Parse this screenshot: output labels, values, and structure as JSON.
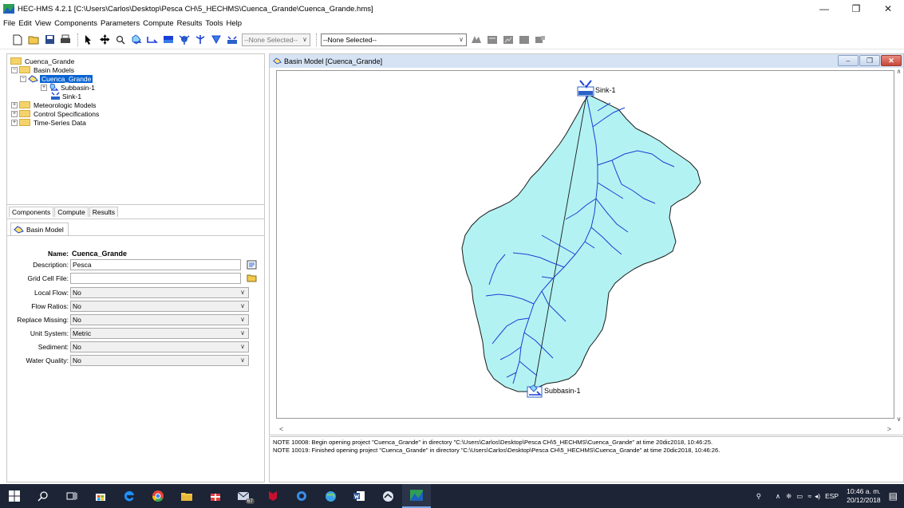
{
  "window": {
    "title": "HEC-HMS 4.2.1 [C:\\Users\\Carlos\\Desktop\\Pesca CH\\5_HECHMS\\Cuenca_Grande\\Cuenca_Grande.hms]",
    "minimize": "—",
    "maximize": "❐",
    "close": "✕"
  },
  "menu": [
    "File",
    "Edit",
    "View",
    "Components",
    "Parameters",
    "Compute",
    "Results",
    "Tools",
    "Help"
  ],
  "toolbar": {
    "select1": "--None Selected--",
    "select2": "--None Selected--"
  },
  "tree": {
    "root": "Cuenca_Grande",
    "basin_models": "Basin Models",
    "basin": "Cuenca_Grande",
    "subbasin": "Subbasin-1",
    "sink": "Sink-1",
    "met_models": "Meteorologic Models",
    "control_specs": "Control Specifications",
    "time_series": "Time-Series Data",
    "expand": "+",
    "collapse": "−"
  },
  "bottom_tabs": [
    "Components",
    "Compute",
    "Results"
  ],
  "props": {
    "tab": "Basin Model",
    "name_label": "Name:",
    "name_value": "Cuenca_Grande",
    "description_label": "Description:",
    "description_value": "Pesca",
    "gridcell_label": "Grid Cell File:",
    "gridcell_value": "",
    "local_flow_label": "Local Flow:",
    "local_flow_value": "No",
    "flow_ratios_label": "Flow Ratios:",
    "flow_ratios_value": "No",
    "replace_missing_label": "Replace Missing:",
    "replace_missing_value": "No",
    "unit_system_label": "Unit System:",
    "unit_system_value": "Metric",
    "sediment_label": "Sediment:",
    "sediment_value": "No",
    "water_quality_label": "Water Quality:",
    "water_quality_value": "No"
  },
  "basin_window": {
    "title": "Basin Model [Cuenca_Grande]",
    "sink_label": "Sink-1",
    "subbasin_label": "Subbasin-1",
    "colors": {
      "fill": "#b3f2f2",
      "outline": "#1a1a1a",
      "stream": "#1a3fd6"
    }
  },
  "messages": [
    "NOTE 10008:  Begin opening project \"Cuenca_Grande\" in directory \"C:\\Users\\Carlos\\Desktop\\Pesca CH\\5_HECHMS\\Cuenca_Grande\" at time 20dic2018, 10:46:25.",
    "NOTE 10019:  Finished opening project \"Cuenca_Grande\" in directory \"C:\\Users\\Carlos\\Desktop\\Pesca CH\\5_HECHMS\\Cuenca_Grande\" at time 20dic2018, 10:46:26."
  ],
  "taskbar": {
    "lang": "ESP",
    "time": "10:46 a. m.",
    "date": "20/12/2018",
    "mail_badge": "67"
  }
}
